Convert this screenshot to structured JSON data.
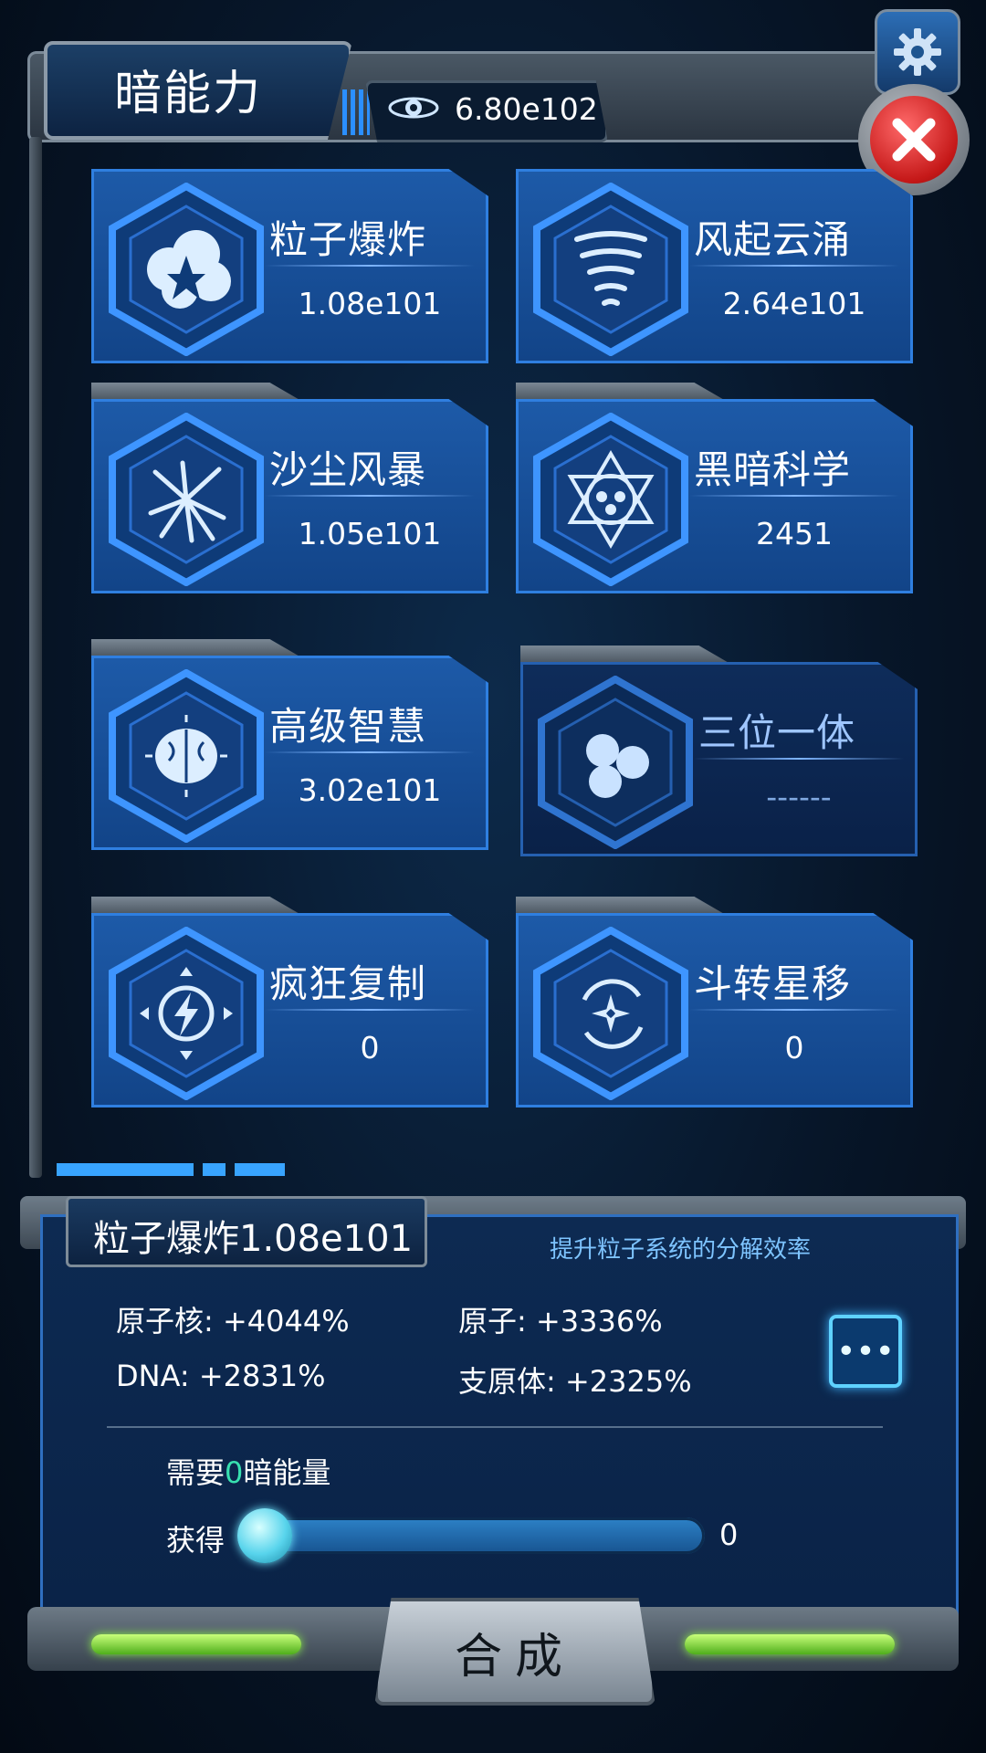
{
  "header": {
    "title": "暗能力",
    "resource_icon": "planet-eye-icon",
    "resource_value": "6.80e102"
  },
  "buttons": {
    "settings_icon": "gear-icon",
    "close_icon": "close-icon"
  },
  "skills": [
    {
      "name": "粒子爆炸",
      "value": "1.08e101",
      "icon": "explosion-icon"
    },
    {
      "name": "风起云涌",
      "value": "2.64e101",
      "icon": "tornado-icon"
    },
    {
      "name": "沙尘风暴",
      "value": "1.05e101",
      "icon": "shatter-icon"
    },
    {
      "name": "黑暗科学",
      "value": "2451",
      "icon": "hexagram-icon"
    },
    {
      "name": "高级智慧",
      "value": "3.02e101",
      "icon": "brain-icon"
    },
    {
      "name": "三位一体",
      "value": "------",
      "icon": "trinity-icon"
    },
    {
      "name": "疯狂复制",
      "value": "0",
      "icon": "lightning-icon"
    },
    {
      "name": "斗转星移",
      "value": "0",
      "icon": "vortex-icon"
    }
  ],
  "detail": {
    "title": "粒子爆炸1.08e101",
    "description": "提升粒子系统的分解效率",
    "stats": [
      "原子核: +4044%",
      "原子: +3336%",
      "DNA: +2831%",
      "支原体: +2325%"
    ],
    "more_label": "•••",
    "need_prefix": "需要",
    "need_amount": "0",
    "need_suffix": "暗能量",
    "get_label": "获得",
    "get_value": "0",
    "slider_fraction": 0
  },
  "compose_label": "合成",
  "colors": {
    "accent": "#2f7fe0",
    "need_number": "#38e0b0",
    "close": "#d42020"
  }
}
